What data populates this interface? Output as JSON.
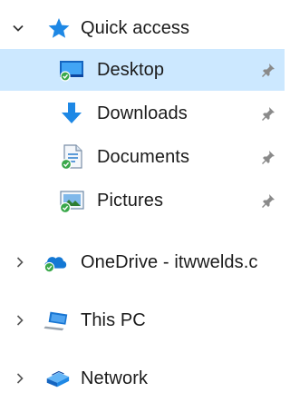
{
  "nav": {
    "quick_access": {
      "label": "Quick access",
      "expanded": true,
      "icon": "star-icon",
      "items": [
        {
          "label": "Desktop",
          "icon": "desktop-icon",
          "pinned": true,
          "selected": true
        },
        {
          "label": "Downloads",
          "icon": "download-arrow-icon",
          "pinned": true,
          "selected": false
        },
        {
          "label": "Documents",
          "icon": "documents-icon",
          "pinned": true,
          "selected": false
        },
        {
          "label": "Pictures",
          "icon": "pictures-icon",
          "pinned": true,
          "selected": false
        }
      ]
    },
    "onedrive": {
      "label": "OneDrive - itwwelds.c",
      "icon": "cloud-icon",
      "expanded": false
    },
    "this_pc": {
      "label": "This PC",
      "icon": "computer-icon",
      "expanded": false
    },
    "network": {
      "label": "Network",
      "icon": "network-icon",
      "expanded": false
    }
  },
  "colors": {
    "selection": "#cce8ff",
    "accent": "#2b7fd8",
    "sync_ok": "#3aa84a"
  }
}
